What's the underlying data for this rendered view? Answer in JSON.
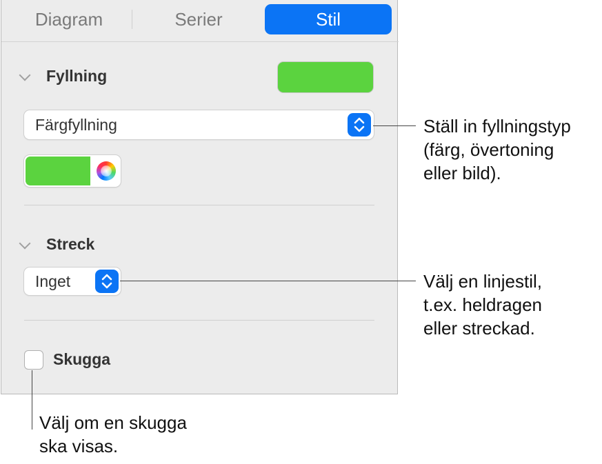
{
  "tabs": [
    {
      "label": "Diagram",
      "active": false
    },
    {
      "label": "Serier",
      "active": false
    },
    {
      "label": "Stil",
      "active": true
    }
  ],
  "fill": {
    "title": "Fyllning",
    "swatch_color": "#5bd33f",
    "type_value": "Färgfyllning",
    "well_color": "#5bd33f"
  },
  "stroke": {
    "title": "Streck",
    "value": "Inget"
  },
  "shadow": {
    "label": "Skugga",
    "checked": false
  },
  "callouts": {
    "fill_type": [
      "Ställ in fyllningstyp",
      "(färg, övertoning",
      "eller bild)."
    ],
    "line_style": [
      "Välj en linjestil,",
      "t.ex. heldragen",
      "eller streckad."
    ],
    "shadow": [
      "Välj om en skugga",
      "ska visas."
    ]
  },
  "colors": {
    "accent": "#0b74f5",
    "fill_green": "#5bd33f",
    "panel_bg": "#ececec"
  }
}
